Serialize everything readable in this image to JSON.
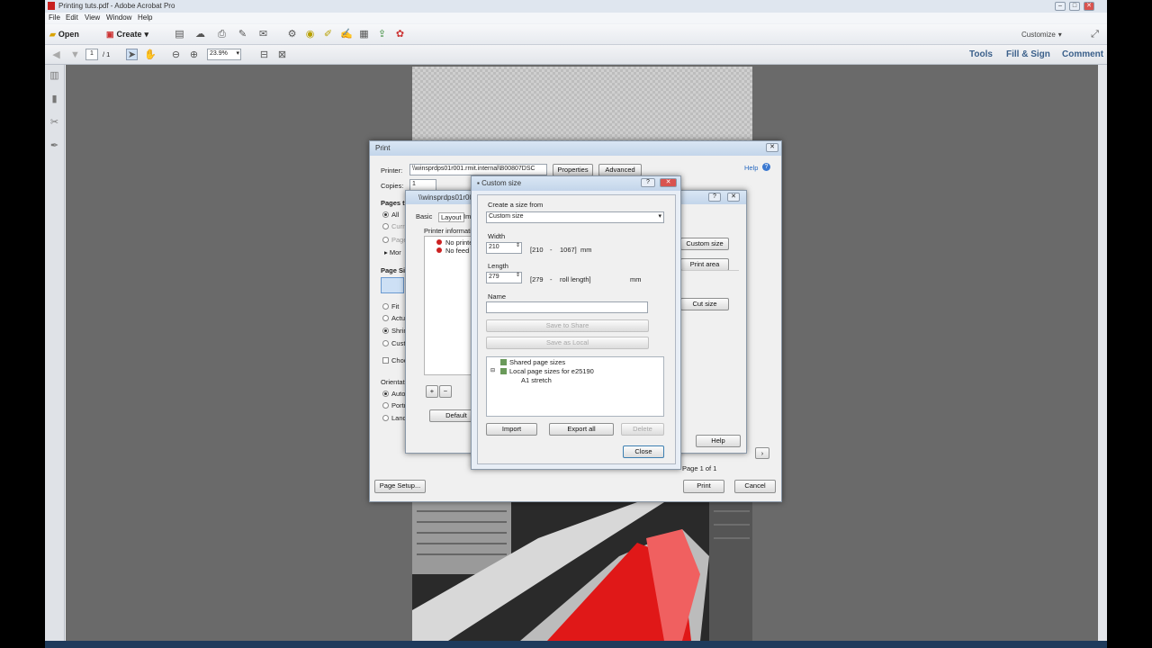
{
  "app": {
    "window_title": "Printing tuts.pdf - Adobe Acrobat Pro",
    "menu": [
      "File",
      "Edit",
      "View",
      "Window",
      "Help"
    ],
    "toolbar": {
      "open": "Open",
      "create": "Create",
      "customize": "Customize"
    },
    "nav": {
      "page": "1",
      "page_total": "/ 1",
      "zoom": "23.9%"
    },
    "right_panes": [
      "Tools",
      "Fill & Sign",
      "Comment"
    ]
  },
  "print_dialog": {
    "title": "Print",
    "printer_label": "Printer:",
    "printer_value": "\\\\winsprdps01r001.rmit.internal\\B00807DSC",
    "properties": "Properties",
    "advanced": "Advanced",
    "help": "Help",
    "copies_label": "Copies:",
    "copies_value": "1",
    "pages_label": "Pages t",
    "opt_all": "All",
    "opt_cur": "Curr",
    "opt_pages": "Page",
    "more": "Mor",
    "page_sizing": "Page Si",
    "fit": "Fit",
    "actual": "Actu",
    "shrink": "Shrin",
    "custom": "Cust",
    "choose": "Choo",
    "orientation": "Orientat",
    "auto": "Auto",
    "portrait": "Portr",
    "landscape": "Land",
    "page_setup": "Page Setup...",
    "print": "Print",
    "cancel": "Cancel",
    "page_of": "Page 1 of 1"
  },
  "props_dialog": {
    "title": "\\\\winsprdps01r00",
    "tabs": [
      "Basic",
      "Layout",
      "Im"
    ],
    "printer_info": "Printer information",
    "no_printer": "No printer",
    "no_feed": "No feed d",
    "default": "Default",
    "custom_size": "Custom size",
    "print_area": "Print area",
    "cut_size": "Cut size",
    "help": "Help"
  },
  "custom_dialog": {
    "title": "Custom size",
    "create_from_label": "Create a size from",
    "create_from_value": "Custom size",
    "width_label": "Width",
    "width_value": "210",
    "width_range_a": "[210",
    "width_range_b": "-",
    "width_range_c": "1067]",
    "width_unit": "mm",
    "length_label": "Length",
    "length_value": "279",
    "length_range_a": "[279",
    "length_range_b": "-",
    "length_range_c": "roll length]",
    "length_unit": "mm",
    "name_label": "Name",
    "name_value": "",
    "save_share": "Save to Share",
    "save_local": "Save as Local",
    "tree_shared": "Shared page sizes",
    "tree_local": "Local page sizes for e25190",
    "tree_item": "A1 stretch",
    "import": "Import",
    "export_all": "Export all",
    "delete": "Delete",
    "close": "Close"
  }
}
